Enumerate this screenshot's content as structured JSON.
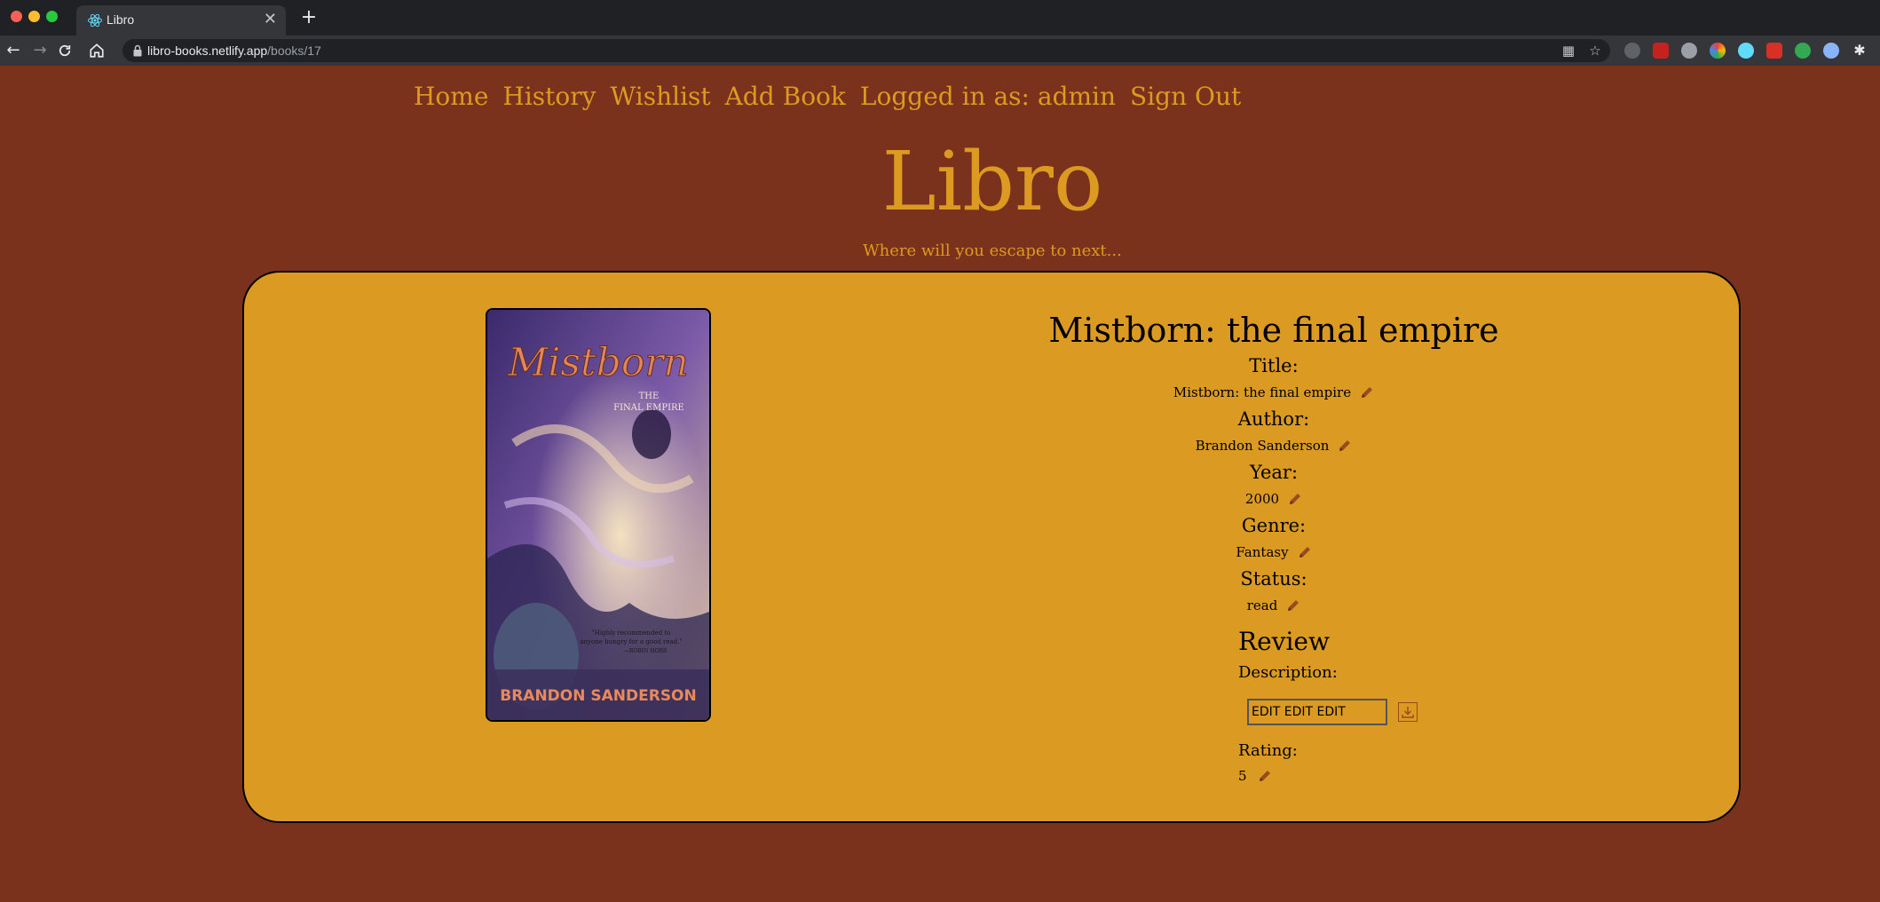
{
  "browser": {
    "tab_title": "Libro",
    "tab_close": "✕",
    "new_tab": "+",
    "url_host": "libro-books.netlify.app",
    "url_path": "/books/17",
    "icons": [
      "back-icon",
      "forward-icon",
      "reload-icon",
      "home-icon",
      "lock-icon",
      "qr-code-icon",
      "bookmark-star-icon",
      "extension-icons",
      "puzzle-icon"
    ]
  },
  "site": {
    "nav": [
      "Home",
      "History",
      "Wishlist",
      "Add Book",
      "Logged in as: admin",
      "Sign Out"
    ],
    "brand": "Libro",
    "tagline": "Where will you escape to next..."
  },
  "book": {
    "heading": "Mistborn: the final empire",
    "cover": {
      "title": "Mistborn",
      "subtitle_line1": "THE",
      "subtitle_line2": "FINAL EMPIRE",
      "quote_line1": "\"Highly recommended to",
      "quote_line2": "anyone hungry for a good read.\"",
      "quote_author": "—ROBIN HOBB",
      "author": "BRANDON SANDERSON"
    },
    "fields": {
      "title_label": "Title:",
      "title_value": "Mistborn: the final empire",
      "author_label": "Author:",
      "author_value": "Brandon Sanderson",
      "year_label": "Year:",
      "year_value": "2000",
      "genre_label": "Genre:",
      "genre_value": "Fantasy",
      "status_label": "Status:",
      "status_value": "read"
    }
  },
  "review": {
    "heading": "Review",
    "description_label": "Description:",
    "description_value": "EDIT EDIT EDIT",
    "rating_label": "Rating:",
    "rating_value": "5"
  },
  "colors": {
    "page_bg": "#7a321c",
    "accent": "#dc9a20",
    "card_bg": "#db9a21",
    "icon_brown": "#9b4a1e"
  }
}
